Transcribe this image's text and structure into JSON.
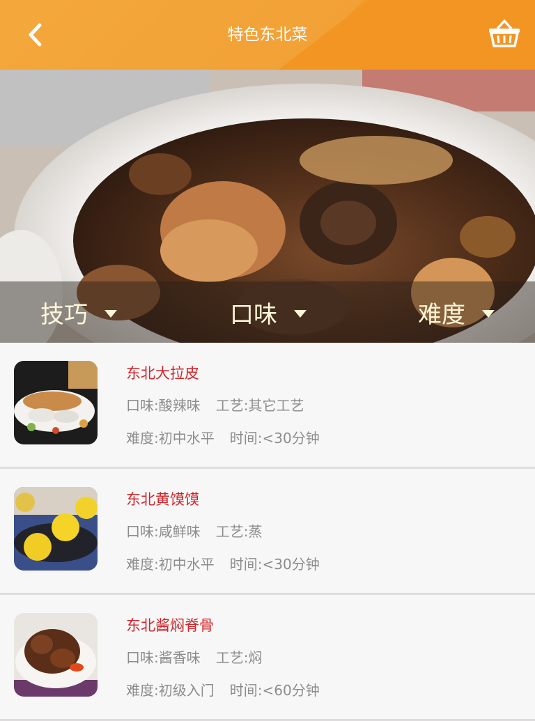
{
  "header": {
    "title": "特色东北菜",
    "back_icon": "chevron-left-icon",
    "basket_icon": "basket-icon",
    "color": "#f29a2a"
  },
  "filters": [
    {
      "label": "技巧"
    },
    {
      "label": "口味"
    },
    {
      "label": "难度"
    }
  ],
  "recipes": [
    {
      "name": "东北大拉皮",
      "taste": "口味:酸辣味",
      "craft": "工艺:其它工艺",
      "difficulty": "难度:初中水平",
      "time": "时间:<30分钟"
    },
    {
      "name": "东北黄馍馍",
      "taste": "口味:咸鲜味",
      "craft": "工艺:蒸",
      "difficulty": "难度:初中水平",
      "time": "时间:<30分钟"
    },
    {
      "name": "东北酱焖脊骨",
      "taste": "口味:酱香味",
      "craft": "工艺:焖",
      "difficulty": "难度:初级入门",
      "time": "时间:<60分钟"
    }
  ],
  "colors": {
    "recipe_name": "#d0262a",
    "meta_text": "#8c8c8c",
    "filter_text": "#fff6d9"
  }
}
